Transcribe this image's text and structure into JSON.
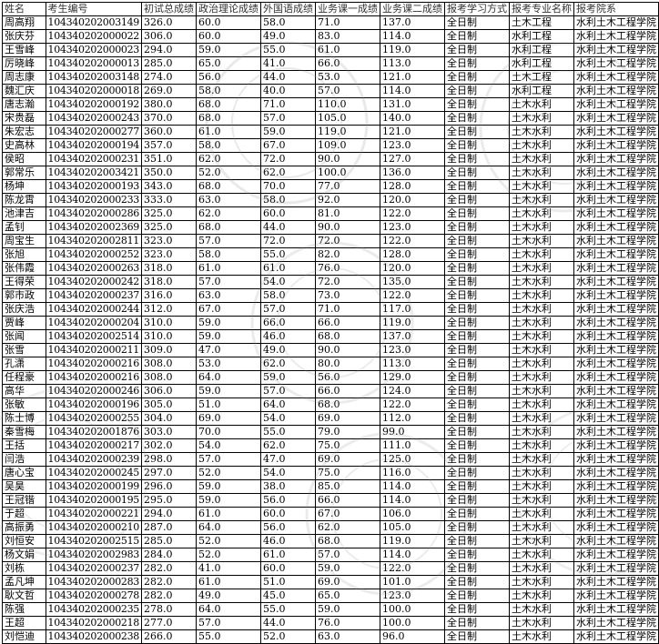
{
  "columns": [
    "姓名",
    "考生编号",
    "初试总成绩",
    "政治理论成绩",
    "外国语成绩",
    "业务课一成绩",
    "业务课二成绩",
    "报考学习方式",
    "报考专业名称",
    "报考院系"
  ],
  "rows": [
    [
      "周高翔",
      "104340202003149",
      "326.0",
      "60.0",
      "58.0",
      "71.0",
      "137.0",
      "全日制",
      "土木工程",
      "水利土木工程学院"
    ],
    [
      "张庆芬",
      "104340202000022",
      "306.0",
      "60.0",
      "49.0",
      "83.0",
      "114.0",
      "全日制",
      "水利工程",
      "水利土木工程学院"
    ],
    [
      "王雪峰",
      "104340202000023",
      "294.0",
      "59.0",
      "55.0",
      "61.0",
      "119.0",
      "全日制",
      "水利工程",
      "水利土木工程学院"
    ],
    [
      "厉晓峰",
      "104340202000013",
      "285.0",
      "65.0",
      "41.0",
      "66.0",
      "113.0",
      "全日制",
      "水利工程",
      "水利土木工程学院"
    ],
    [
      "周志康",
      "104340202003148",
      "274.0",
      "56.0",
      "44.0",
      "53.0",
      "121.0",
      "全日制",
      "土木工程",
      "水利土木工程学院"
    ],
    [
      "魏汇庆",
      "104340202000018",
      "269.0",
      "58.0",
      "40.0",
      "57.0",
      "114.0",
      "全日制",
      "水利工程",
      "水利土木工程学院"
    ],
    [
      "唐志瀚",
      "104340202000192",
      "380.0",
      "68.0",
      "71.0",
      "110.0",
      "131.0",
      "全日制",
      "土木水利",
      "水利土木工程学院"
    ],
    [
      "宋贵磊",
      "104340202000243",
      "370.0",
      "68.0",
      "57.0",
      "105.0",
      "140.0",
      "全日制",
      "土木水利",
      "水利土木工程学院"
    ],
    [
      "朱宏志",
      "104340202000277",
      "360.0",
      "61.0",
      "59.0",
      "119.0",
      "121.0",
      "全日制",
      "土木水利",
      "水利土木工程学院"
    ],
    [
      "史高林",
      "104340202000194",
      "357.0",
      "58.0",
      "67.0",
      "109.0",
      "123.0",
      "全日制",
      "土木水利",
      "水利土木工程学院"
    ],
    [
      "侯昭",
      "104340202000231",
      "351.0",
      "62.0",
      "72.0",
      "90.0",
      "127.0",
      "全日制",
      "土木水利",
      "水利土木工程学院"
    ],
    [
      "郭常乐",
      "104340202003421",
      "350.0",
      "52.0",
      "62.0",
      "100.0",
      "136.0",
      "全日制",
      "土木水利",
      "水利土木工程学院"
    ],
    [
      "杨坤",
      "104340202000193",
      "343.0",
      "68.0",
      "70.0",
      "77.0",
      "128.0",
      "全日制",
      "土木水利",
      "水利土木工程学院"
    ],
    [
      "陈龙霄",
      "104340202000233",
      "333.0",
      "63.0",
      "58.0",
      "92.0",
      "120.0",
      "全日制",
      "土木水利",
      "水利土木工程学院"
    ],
    [
      "池津吉",
      "104340202000286",
      "325.0",
      "62.0",
      "60.0",
      "81.0",
      "122.0",
      "全日制",
      "土木水利",
      "水利土木工程学院"
    ],
    [
      "孟钊",
      "104340202002369",
      "325.0",
      "68.0",
      "44.0",
      "90.0",
      "123.0",
      "全日制",
      "土木水利",
      "水利土木工程学院"
    ],
    [
      "周宝生",
      "104340202002811",
      "323.0",
      "57.0",
      "72.0",
      "72.0",
      "122.0",
      "全日制",
      "土木水利",
      "水利土木工程学院"
    ],
    [
      "张旭",
      "104340202000252",
      "323.0",
      "58.0",
      "55.0",
      "82.0",
      "128.0",
      "全日制",
      "土木水利",
      "水利土木工程学院"
    ],
    [
      "张伟霞",
      "104340202000263",
      "318.0",
      "61.0",
      "61.0",
      "76.0",
      "120.0",
      "全日制",
      "土木水利",
      "水利土木工程学院"
    ],
    [
      "王得荣",
      "104340202000242",
      "318.0",
      "57.0",
      "54.0",
      "72.0",
      "135.0",
      "全日制",
      "土木水利",
      "水利土木工程学院"
    ],
    [
      "郭市政",
      "104340202000237",
      "316.0",
      "63.0",
      "58.0",
      "73.0",
      "122.0",
      "全日制",
      "土木水利",
      "水利土木工程学院"
    ],
    [
      "张庆浩",
      "104340202000244",
      "312.0",
      "67.0",
      "57.0",
      "71.0",
      "117.0",
      "全日制",
      "土木水利",
      "水利土木工程学院"
    ],
    [
      "贾峰",
      "104340202000204",
      "310.0",
      "59.0",
      "66.0",
      "66.0",
      "119.0",
      "全日制",
      "土木水利",
      "水利土木工程学院"
    ],
    [
      "张闻",
      "104340202002514",
      "310.0",
      "59.0",
      "46.0",
      "68.0",
      "137.0",
      "全日制",
      "土木水利",
      "水利土木工程学院"
    ],
    [
      "张雪",
      "104340202000211",
      "309.0",
      "47.0",
      "49.0",
      "90.0",
      "123.0",
      "全日制",
      "土木水利",
      "水利土木工程学院"
    ],
    [
      "孔潇",
      "104340202000216",
      "308.0",
      "53.0",
      "62.0",
      "80.0",
      "113.0",
      "全日制",
      "土木水利",
      "水利土木工程学院"
    ],
    [
      "任程豪",
      "104340202000216",
      "308.0",
      "64.0",
      "59.0",
      "56.0",
      "129.0",
      "全日制",
      "土木水利",
      "水利土木工程学院"
    ],
    [
      "高华",
      "104340202000246",
      "306.0",
      "59.0",
      "57.0",
      "66.0",
      "124.0",
      "全日制",
      "土木水利",
      "水利土木工程学院"
    ],
    [
      "张敏",
      "104340202000196",
      "305.0",
      "51.0",
      "64.0",
      "68.0",
      "122.0",
      "全日制",
      "土木水利",
      "水利土木工程学院"
    ],
    [
      "陈士博",
      "104340202000255",
      "304.0",
      "69.0",
      "54.0",
      "69.0",
      "112.0",
      "全日制",
      "土木水利",
      "水利土木工程学院"
    ],
    [
      "秦雪梅",
      "104340202001876",
      "303.0",
      "70.0",
      "55.0",
      "79.0",
      "99.0",
      "全日制",
      "土木水利",
      "水利土木工程学院"
    ],
    [
      "王括",
      "104340202000217",
      "302.0",
      "54.0",
      "62.0",
      "75.0",
      "111.0",
      "全日制",
      "土木水利",
      "水利土木工程学院"
    ],
    [
      "闫浩",
      "104340202000239",
      "298.0",
      "57.0",
      "47.0",
      "69.0",
      "125.0",
      "全日制",
      "土木水利",
      "水利土木工程学院"
    ],
    [
      "唐心宝",
      "104340202000245",
      "297.0",
      "52.0",
      "54.0",
      "75.0",
      "116.0",
      "全日制",
      "土木水利",
      "水利土木工程学院"
    ],
    [
      "吴昊",
      "104340202000199",
      "296.0",
      "59.0",
      "38.0",
      "85.0",
      "114.0",
      "全日制",
      "土木水利",
      "水利土木工程学院"
    ],
    [
      "王冠锴",
      "104340202000195",
      "295.0",
      "59.0",
      "56.0",
      "66.0",
      "114.0",
      "全日制",
      "土木水利",
      "水利土木工程学院"
    ],
    [
      "于超",
      "104340202000221",
      "294.0",
      "61.0",
      "60.0",
      "67.0",
      "106.0",
      "全日制",
      "土木水利",
      "水利土木工程学院"
    ],
    [
      "高振勇",
      "104340202000210",
      "287.0",
      "64.0",
      "56.0",
      "62.0",
      "105.0",
      "全日制",
      "土木水利",
      "水利土木工程学院"
    ],
    [
      "刘恒安",
      "104340202002515",
      "285.0",
      "52.0",
      "46.0",
      "68.0",
      "119.0",
      "全日制",
      "土木水利",
      "水利土木工程学院"
    ],
    [
      "杨文娟",
      "104340202002983",
      "284.0",
      "52.0",
      "61.0",
      "57.0",
      "114.0",
      "全日制",
      "土木水利",
      "水利土木工程学院"
    ],
    [
      "刘栋",
      "104340202000237",
      "282.0",
      "41.0",
      "60.0",
      "59.0",
      "122.0",
      "全日制",
      "土木水利",
      "水利土木工程学院"
    ],
    [
      "孟凡坤",
      "104340202000283",
      "282.0",
      "61.0",
      "51.0",
      "69.0",
      "101.0",
      "全日制",
      "土木水利",
      "水利土木工程学院"
    ],
    [
      "耿文哲",
      "104340202000278",
      "282.0",
      "49.0",
      "45.0",
      "65.0",
      "123.0",
      "全日制",
      "土木水利",
      "水利土木工程学院"
    ],
    [
      "陈强",
      "104340202000235",
      "278.0",
      "64.0",
      "55.0",
      "59.0",
      "100.0",
      "全日制",
      "土木水利",
      "水利土木工程学院"
    ],
    [
      "王超",
      "104340202000218",
      "277.0",
      "57.0",
      "44.0",
      "76.0",
      "100.0",
      "全日制",
      "土木水利",
      "水利土木工程学院"
    ],
    [
      "刘恺迪",
      "104340202000238",
      "266.0",
      "55.0",
      "52.0",
      "63.0",
      "96.0",
      "全日制",
      "土木水利",
      "水利土木工程学院"
    ]
  ],
  "colors": {
    "grid": "#000000",
    "text": "#000000",
    "watermark": "#8a8a8a"
  }
}
